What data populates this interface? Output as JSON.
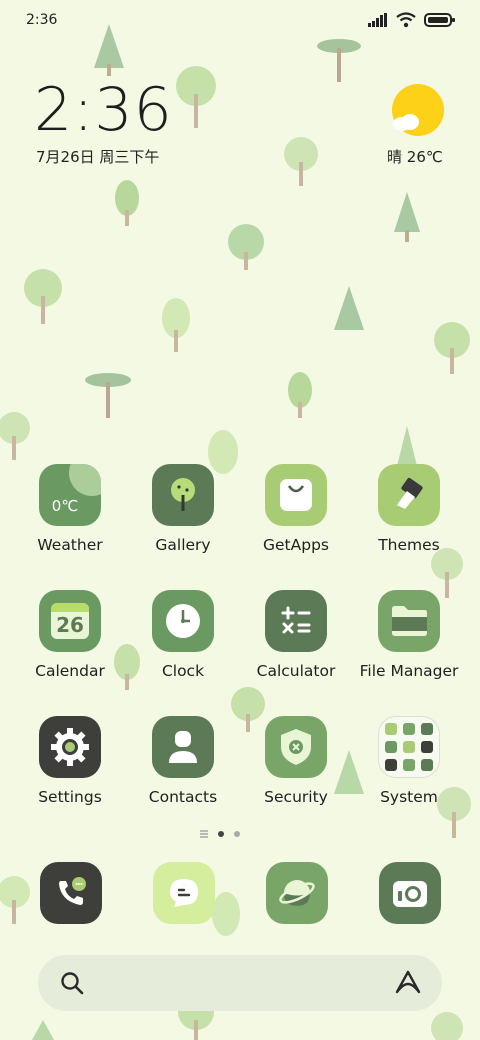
{
  "status_bar": {
    "time": "2:36",
    "icons": [
      "signal-icon",
      "wifi-icon",
      "battery-icon"
    ]
  },
  "clock_widget": {
    "time": "2:36",
    "date": "7月26日 周三下午"
  },
  "weather_widget": {
    "condition": "晴",
    "temperature": "26℃",
    "icon": "sunny-cloud-icon"
  },
  "apps": [
    {
      "label": "Weather",
      "icon": "weather-icon",
      "badge": "0℃"
    },
    {
      "label": "Gallery",
      "icon": "tree-icon"
    },
    {
      "label": "GetApps",
      "icon": "shopping-bag-icon"
    },
    {
      "label": "Themes",
      "icon": "paintbrush-icon"
    },
    {
      "label": "Calendar",
      "icon": "calendar-icon",
      "badge": "26"
    },
    {
      "label": "Clock",
      "icon": "clock-icon"
    },
    {
      "label": "Calculator",
      "icon": "calculator-icon"
    },
    {
      "label": "File Manager",
      "icon": "folder-icon"
    },
    {
      "label": "Settings",
      "icon": "gear-icon"
    },
    {
      "label": "Contacts",
      "icon": "person-icon"
    },
    {
      "label": "Security",
      "icon": "shield-icon"
    },
    {
      "label": "System",
      "icon": "folder-grid-icon"
    }
  ],
  "pages": {
    "count": 2,
    "current": 1
  },
  "dock": [
    {
      "icon": "phone-icon"
    },
    {
      "icon": "messages-icon"
    },
    {
      "icon": "browser-icon"
    },
    {
      "icon": "camera-icon"
    }
  ],
  "search": {
    "icon": "search-icon",
    "assistant_icon": "assistant-icon"
  },
  "colors": {
    "background": "#f3f9e3",
    "dark_green": "#5b7a55",
    "mid_green": "#7aa569",
    "light_green": "#a8c97c",
    "sun": "#fcd118"
  }
}
